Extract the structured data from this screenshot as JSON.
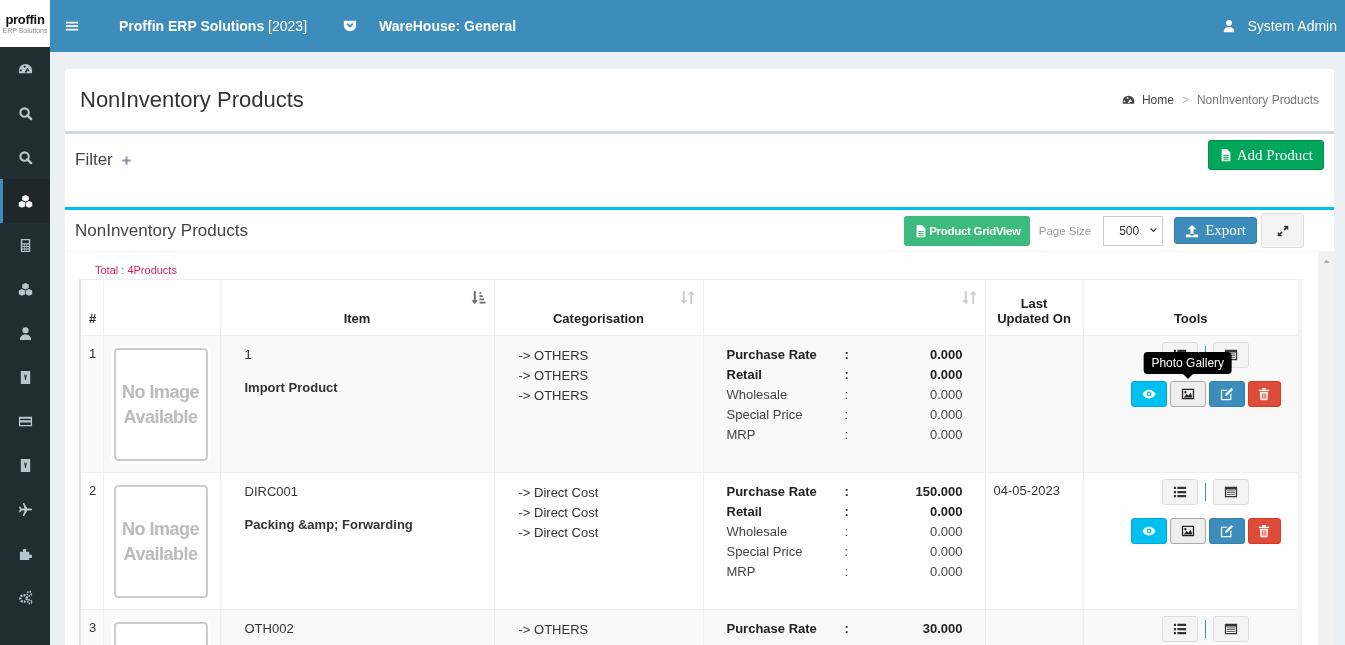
{
  "logo": {
    "name": "proffin",
    "subtitle": "ERP Solutions"
  },
  "sidebar": {
    "items": [
      {
        "kind": "dashboard",
        "selected": false
      },
      {
        "kind": "search",
        "selected": false
      },
      {
        "kind": "search",
        "selected": false
      },
      {
        "kind": "cubes",
        "selected": true
      },
      {
        "kind": "calculator",
        "selected": false
      },
      {
        "kind": "cubes",
        "selected": false
      },
      {
        "kind": "user",
        "selected": false
      },
      {
        "kind": "badge",
        "selected": false
      },
      {
        "kind": "card",
        "selected": false
      },
      {
        "kind": "badge",
        "selected": false
      },
      {
        "kind": "plane",
        "selected": false
      },
      {
        "kind": "puzzle",
        "selected": false
      },
      {
        "kind": "cogs",
        "selected": false
      }
    ]
  },
  "topbar": {
    "app_title": "**Proffin ERP Solutions** [2023]",
    "warehouse": "WareHouse: General",
    "user": "System Admin"
  },
  "page": {
    "title": "NonInventory Products",
    "breadcrumb_separator": ">",
    "breadcrumb": [
      {
        "label": "Home",
        "current": false
      },
      {
        "label": "NonInventory Products",
        "current": true
      }
    ]
  },
  "filter": {
    "label": "Filter",
    "add_button": "Add Product"
  },
  "list": {
    "title": "NonInventory Products",
    "gridview_button": "Product GridView",
    "page_size_label": "Page Size",
    "page_size": "500",
    "export_button": "Export",
    "total": "Total : 4Products"
  },
  "table": {
    "columns": [
      {
        "label": "#",
        "kind": "plain"
      },
      {
        "kind": "plain"
      },
      {
        "label": "Item",
        "kind": "sorted"
      },
      {
        "label": "Categorisation",
        "kind": "sortable"
      },
      {
        "kind": "sortable"
      },
      {
        "label": "Last Updated On",
        "kind": "plain"
      },
      {
        "label": "Tools",
        "kind": "plain"
      }
    ],
    "rows": [
      {
        "number": "1",
        "image_text": "No Image Available",
        "code": "1",
        "name": "Import Product",
        "categories": [
          "-> OTHERS",
          "-> OTHERS",
          "-> OTHERS"
        ],
        "prices": [
          {
            "label": "Purchase Rate",
            "sep": ":",
            "value": "0.000",
            "emphasis": true
          },
          {
            "label": "Retail",
            "sep": ":",
            "value": "0.000",
            "emphasis": true
          },
          {
            "label": "Wholesale",
            "sep": ":",
            "value": "0.000",
            "emphasis": false
          },
          {
            "label": "Special Price",
            "sep": ":",
            "value": "0.000",
            "emphasis": false
          },
          {
            "label": "MRP",
            "sep": ":",
            "value": "0.000",
            "emphasis": false
          }
        ],
        "tools": [
          {
            "kind": "list"
          },
          {
            "kind": "details"
          },
          {
            "kind": "view"
          },
          {
            "kind": "gallery",
            "tooltip": "Photo Gallery"
          },
          {
            "kind": "edit"
          },
          {
            "kind": "delete"
          }
        ]
      },
      {
        "number": "2",
        "image_text": "No Image Available",
        "code": "DIRC001",
        "name": "Packing &amp; Forwarding",
        "categories": [
          "-> Direct Cost",
          "-> Direct Cost",
          "-> Direct Cost"
        ],
        "prices": [
          {
            "label": "Purchase Rate",
            "sep": ":",
            "value": "150.000",
            "emphasis": true
          },
          {
            "label": "Retail",
            "sep": ":",
            "value": "0.000",
            "emphasis": true
          },
          {
            "label": "Wholesale",
            "sep": ":",
            "value": "0.000",
            "emphasis": false
          },
          {
            "label": "Special Price",
            "sep": ":",
            "value": "0.000",
            "emphasis": false
          },
          {
            "label": "MRP",
            "sep": ":",
            "value": "0.000",
            "emphasis": false
          }
        ],
        "updated": "04-05-2023",
        "tools": [
          {
            "kind": "list"
          },
          {
            "kind": "details"
          },
          {
            "kind": "view"
          },
          {
            "kind": "gallery"
          },
          {
            "kind": "edit"
          },
          {
            "kind": "delete"
          }
        ]
      },
      {
        "number": "3",
        "code": "OTH002",
        "categories": [
          "-> OTHERS"
        ],
        "prices": [
          {
            "label": "Purchase Rate",
            "sep": ":",
            "value": "30.000",
            "emphasis": true
          }
        ],
        "tools": [
          {
            "kind": "list"
          },
          {
            "kind": "details"
          }
        ]
      }
    ]
  }
}
